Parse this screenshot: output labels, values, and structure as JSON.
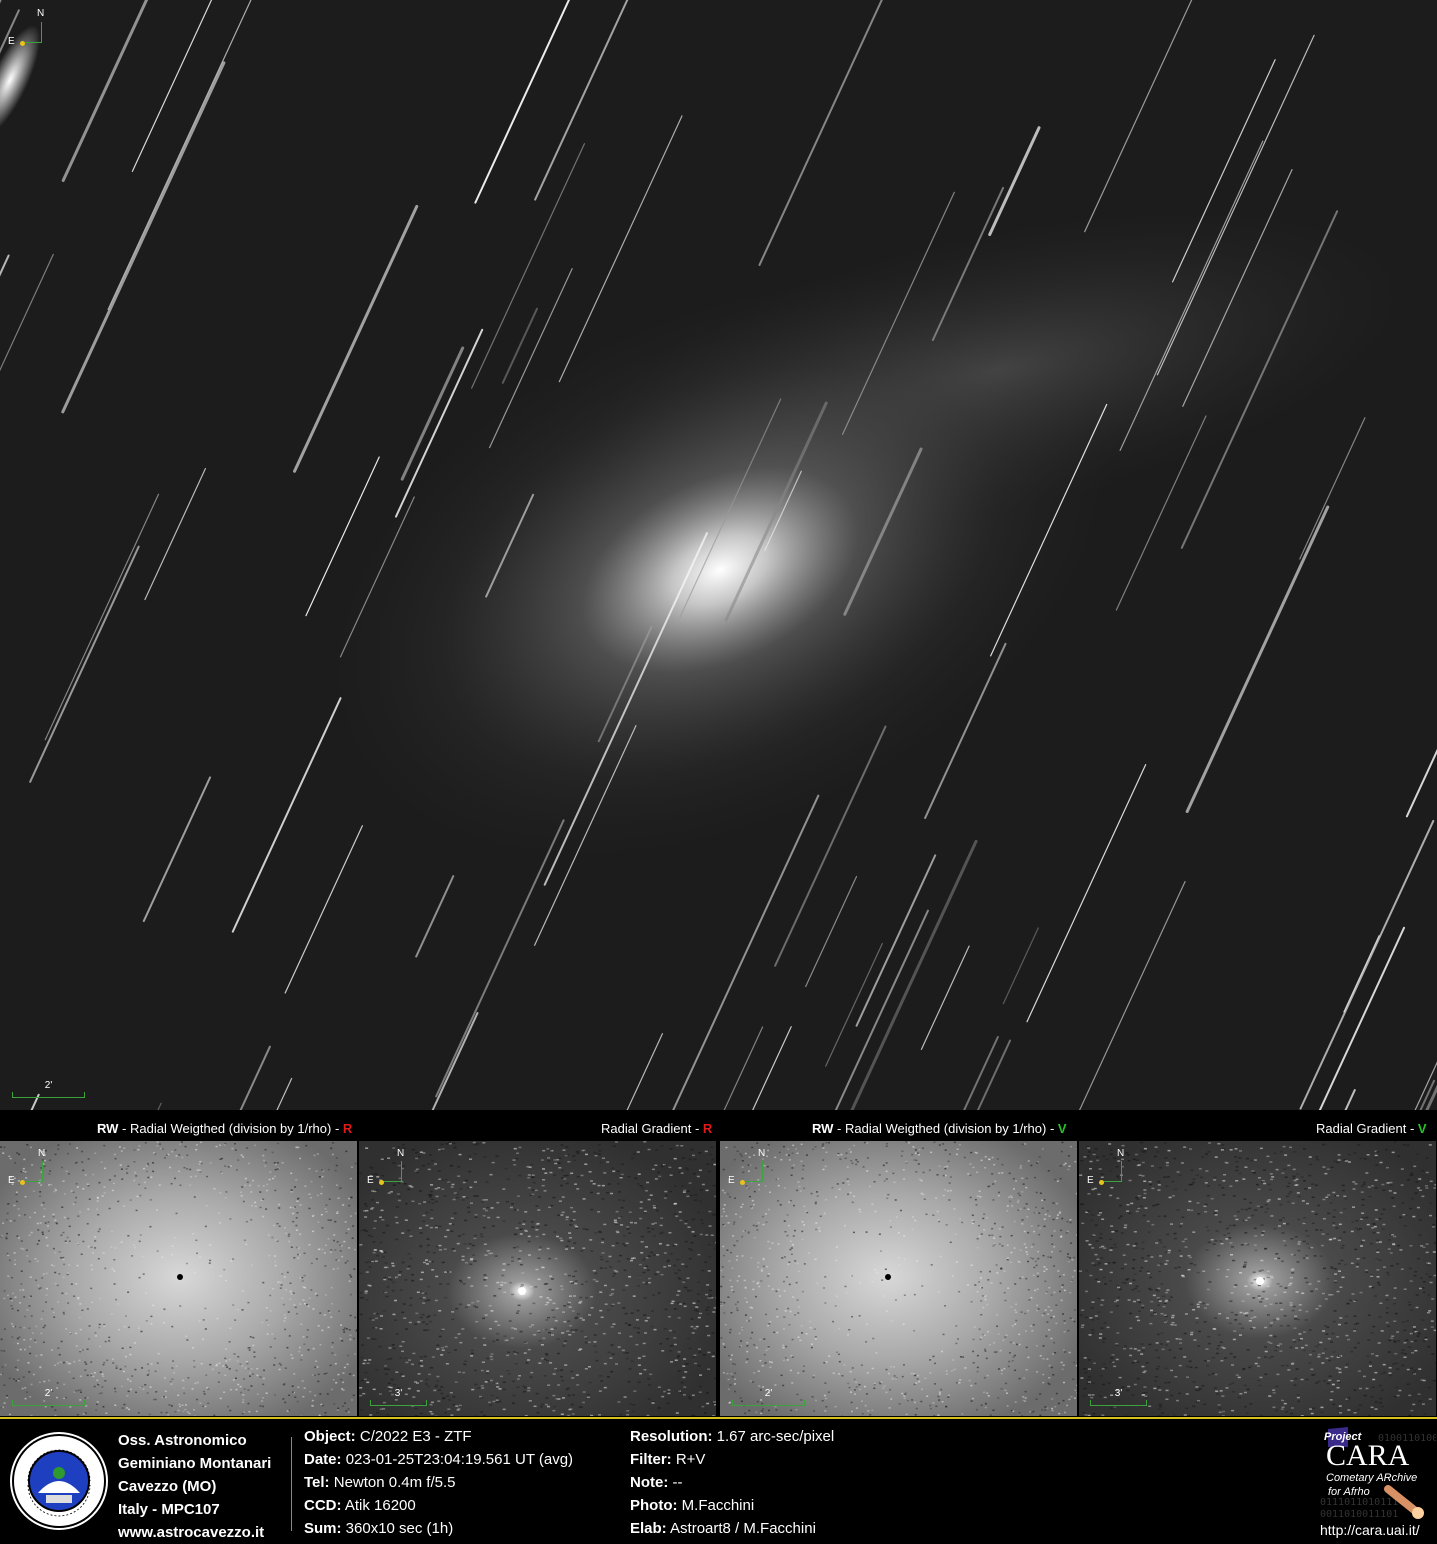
{
  "main_image": {
    "compass": {
      "north": "N",
      "east": "E"
    },
    "scale_label": "2'"
  },
  "panels": [
    {
      "prefix": "RW",
      "title": " - Radial Weigthed (division by 1/rho) - ",
      "filter": "R",
      "filter_color": "#e41a1a",
      "compass_n": "N",
      "compass_e": "E",
      "scale_label": "2'"
    },
    {
      "prefix": "",
      "title": "Radial Gradient - ",
      "filter": "R",
      "filter_color": "#e41a1a",
      "compass_n": "N",
      "compass_e": "E",
      "scale_label": "3'"
    },
    {
      "prefix": "RW",
      "title": " - Radial Weigthed (division by 1/rho) - ",
      "filter": "V",
      "filter_color": "#27c427",
      "compass_n": "N",
      "compass_e": "E",
      "scale_label": "2'"
    },
    {
      "prefix": "",
      "title": "Radial Gradient - ",
      "filter": "V",
      "filter_color": "#27c427",
      "compass_n": "N",
      "compass_e": "E",
      "scale_label": "3'"
    }
  ],
  "observatory": {
    "line1": "Oss. Astronomico",
    "line2": "Geminiano Montanari",
    "line3": "Cavezzo (MO)",
    "line4": "Italy - MPC107",
    "line5": "www.astrocavezzo.it"
  },
  "info_left": [
    {
      "key": "Object:",
      "value": "C/2022 E3 - ZTF"
    },
    {
      "key": "Date:",
      "value": "023-01-25T23:04:19.561 UT (avg)"
    },
    {
      "key": "Tel:",
      "value": "Newton 0.4m f/5.5"
    },
    {
      "key": "CCD:",
      "value": "Atik 16200"
    },
    {
      "key": "Sum:",
      "value": "360x10 sec (1h)"
    }
  ],
  "info_right": [
    {
      "key": "Resolution:",
      "value": "1.67 arc-sec/pixel"
    },
    {
      "key": "Filter:",
      "value": "R+V"
    },
    {
      "key": "Note:",
      "value": "--"
    },
    {
      "key": "Photo:",
      "value": "M.Facchini"
    },
    {
      "key": "Elab:",
      "value": "Astroart8 / M.Facchini"
    }
  ],
  "cara": {
    "project": "Project",
    "name": "CARA",
    "subtitle1": "Cometary ARchive",
    "subtitle2": "for Afrho",
    "url": "http://cara.uai.it/"
  },
  "colors": {
    "accent_yellow": "#d6c21c",
    "compass_green": "#3ba33b",
    "compass_dot": "#e9c21b"
  }
}
